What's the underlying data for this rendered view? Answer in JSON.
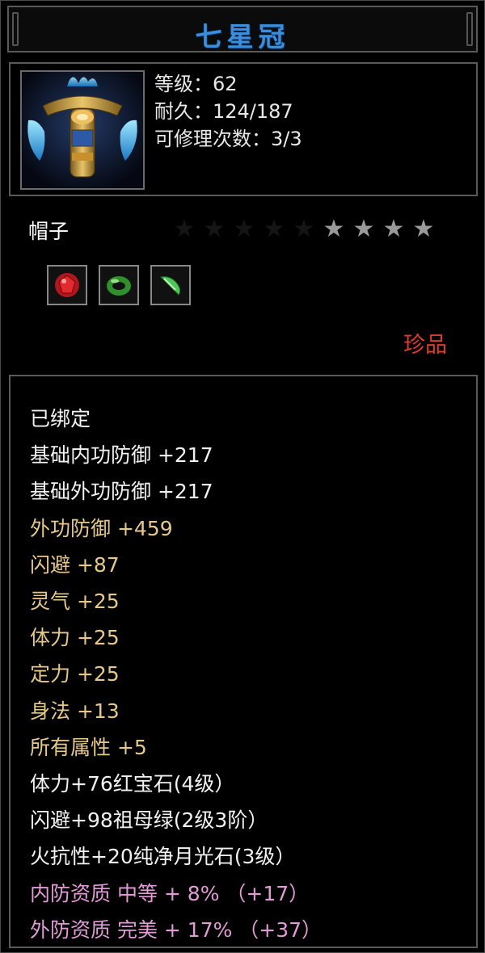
{
  "item": {
    "name": "七星冠",
    "stats": {
      "level": "等级：62",
      "durability": "耐久：124/187",
      "repair": "可修理次数：3/3"
    },
    "type": "帽子",
    "stars": {
      "total": 9,
      "lit": 4
    },
    "gems": [
      {
        "icon": "ruby-gem-icon",
        "color": "#c8202a"
      },
      {
        "icon": "jade-ring-icon",
        "color": "#3fa33a"
      },
      {
        "icon": "moonstone-crystal-icon",
        "color": "#5ad06a"
      }
    ],
    "rarity": "珍品",
    "rarity_color": "#e03a30",
    "attributes": [
      {
        "text": "已绑定",
        "color": "white"
      },
      {
        "text": "基础内功防御  +217",
        "color": "white"
      },
      {
        "text": "基础外功防御  +217",
        "color": "white"
      },
      {
        "text": "外功防御  +459",
        "color": "gold"
      },
      {
        "text": "闪避  +87",
        "color": "gold"
      },
      {
        "text": "灵气  +25",
        "color": "gold"
      },
      {
        "text": "体力  +25",
        "color": "gold"
      },
      {
        "text": "定力  +25",
        "color": "gold"
      },
      {
        "text": "身法  +13",
        "color": "gold"
      },
      {
        "text": "所有属性  +5",
        "color": "gold"
      },
      {
        "text": "体力+76红宝石(4级）",
        "color": "white"
      },
      {
        "text": "闪避+98祖母绿(2级3阶）",
        "color": "white"
      },
      {
        "text": "火抗性+20纯净月光石(3级）",
        "color": "white"
      },
      {
        "text": "内防资质  中等  +  8% （+17）",
        "color": "pink"
      },
      {
        "text": "外防资质  完美  +  17% （+37）",
        "color": "pink"
      }
    ]
  },
  "colors": {
    "title": "#3a8fdc",
    "gold": "#e6c98a",
    "pink": "#e29bd7",
    "border": "#5a5a5a"
  }
}
